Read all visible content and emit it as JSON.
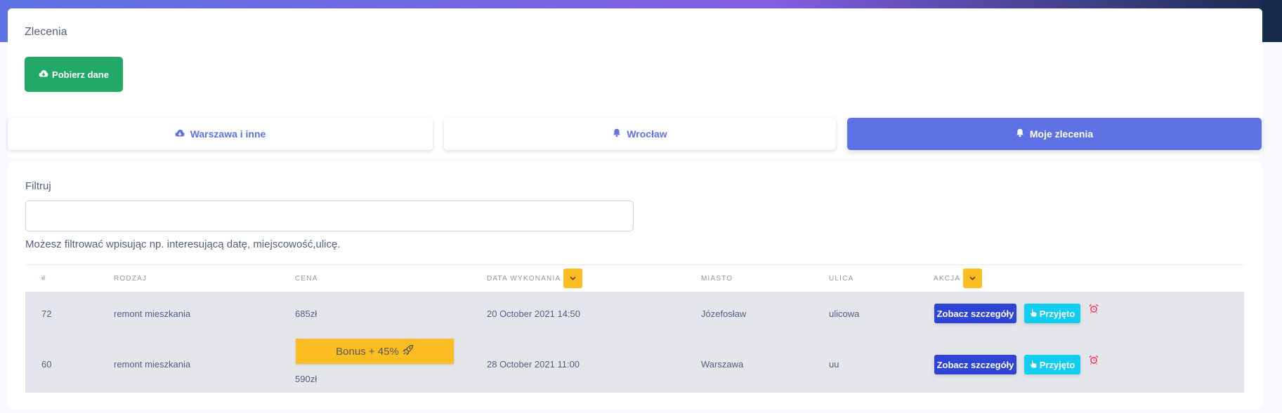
{
  "header": {
    "title": "Zlecenia",
    "download_label": "Pobierz dane"
  },
  "tabs": [
    {
      "label": "Warszawa i inne",
      "icon": "cloud-download-icon",
      "active": false
    },
    {
      "label": "Wrocław",
      "icon": "bell-icon",
      "active": false
    },
    {
      "label": "Moje zlecenia",
      "icon": "bell-icon",
      "active": true
    }
  ],
  "filter": {
    "label": "Filtruj",
    "value": "",
    "placeholder": "",
    "help": "Możesz filtrować wpisując np. interesującą datę, miejscowość,ulicę."
  },
  "table": {
    "columns": [
      "#",
      "RODZAJ",
      "CENA",
      "DATA WYKONANIA",
      "MIASTO",
      "ULICA",
      "AKCJA"
    ],
    "rows": [
      {
        "id": "72",
        "type": "remont mieszkania",
        "price": "685zł",
        "bonus": "",
        "date": "20 October 2021 14:50",
        "city": "Józefosław",
        "street": "ulicowa"
      },
      {
        "id": "60",
        "type": "remont mieszkania",
        "price": "590zł",
        "bonus": "Bonus + 45%",
        "date": "28 October 2021 11:00",
        "city": "Warszawa",
        "street": "uu"
      }
    ],
    "details_label": "Zobacz szczegóły",
    "accept_label": "Przyjęto"
  },
  "colors": {
    "primary": "#5e72e4",
    "success": "#22a867",
    "warning": "#fbbd22",
    "info": "#11cdef",
    "details": "#2e44d6",
    "danger": "#f5365c"
  }
}
